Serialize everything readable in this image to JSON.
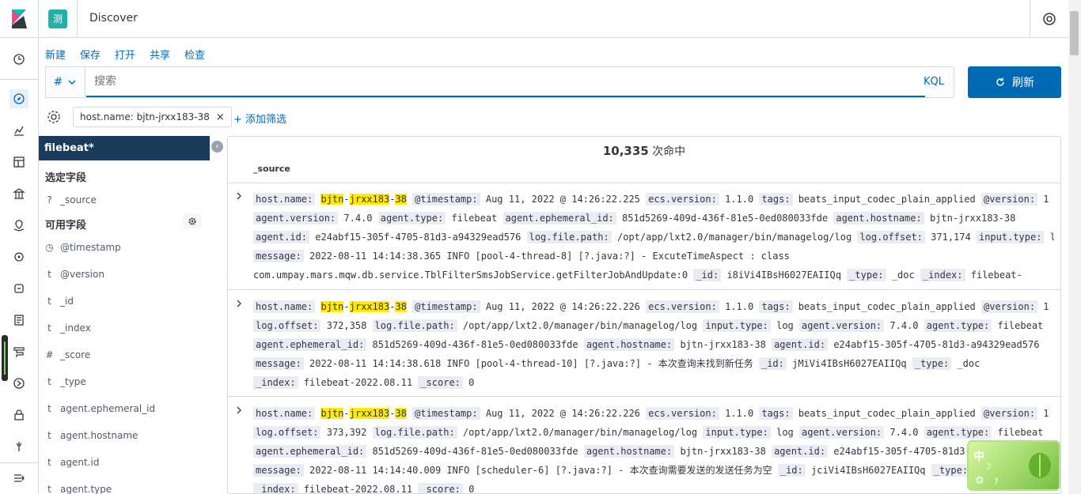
{
  "app": {
    "breadcrumb": "Discover",
    "space_initial": "测"
  },
  "menu": [
    "新建",
    "保存",
    "打开",
    "共享",
    "检查"
  ],
  "query": {
    "lang_symbol": "#",
    "placeholder": "搜索",
    "kql": "KQL",
    "refresh": "刷新"
  },
  "filters": {
    "pill": "host.name: bjtn-jrxx183-38",
    "add": "+ 添加筛选"
  },
  "sidebar": {
    "index": "filebeat*",
    "selected_title": "选定字段",
    "selected": [
      {
        "type": "?",
        "name": "_source"
      }
    ],
    "available_title": "可用字段",
    "available": [
      {
        "type": "◷",
        "name": "@timestamp"
      },
      {
        "type": "t",
        "name": "@version"
      },
      {
        "type": "t",
        "name": "_id"
      },
      {
        "type": "t",
        "name": "_index"
      },
      {
        "type": "#",
        "name": "_score"
      },
      {
        "type": "t",
        "name": "_type"
      },
      {
        "type": "t",
        "name": "agent.ephemeral_id"
      },
      {
        "type": "t",
        "name": "agent.hostname"
      },
      {
        "type": "t",
        "name": "agent.id"
      },
      {
        "type": "t",
        "name": "agent.type"
      }
    ]
  },
  "results": {
    "count": "10,335",
    "count_suffix": "次命中",
    "column": "_source"
  },
  "rows": [
    {
      "lines": [
        [
          [
            "host.name:",
            ""
          ],
          [
            "bjtn",
            "hl"
          ],
          [
            "-",
            ""
          ],
          [
            "jrxx183",
            "hl"
          ],
          [
            "-",
            ""
          ],
          [
            "38",
            "hl"
          ],
          [
            "@timestamp:",
            ""
          ],
          [
            "Aug 11, 2022 @ 14:26:22.225",
            ""
          ],
          [
            "ecs.version:",
            ""
          ],
          [
            "1.1.0",
            ""
          ],
          [
            "tags:",
            ""
          ],
          [
            "beats_input_codec_plain_applied",
            ""
          ],
          [
            "@version:",
            ""
          ],
          [
            "1",
            ""
          ]
        ],
        [
          [
            "agent.version:",
            ""
          ],
          [
            "7.4.0",
            ""
          ],
          [
            "agent.type:",
            ""
          ],
          [
            "filebeat",
            ""
          ],
          [
            "agent.ephemeral_id:",
            ""
          ],
          [
            "851d5269-409d-436f-81e5-0ed080033fde",
            ""
          ],
          [
            "agent.hostname:",
            ""
          ],
          [
            "bjtn-jrxx183-38",
            ""
          ]
        ],
        [
          [
            "agent.id:",
            ""
          ],
          [
            "e24abf15-305f-4705-81d3-a94329ead576",
            ""
          ],
          [
            "log.file.path:",
            ""
          ],
          [
            "/opt/app/lxt2.0/manager/bin/managelog/log",
            ""
          ],
          [
            "log.offset:",
            ""
          ],
          [
            "371,174",
            ""
          ],
          [
            "input.type:",
            ""
          ],
          [
            "log",
            ""
          ]
        ],
        [
          [
            "message:",
            ""
          ],
          [
            "2022-08-11 14:14:38.365 INFO [pool-4-thread-8] [?.java:?] - ExcuteTimeAspect : class",
            ""
          ]
        ],
        [
          [
            "com.umpay.mars.mqw.db.service.TblFilterSmsJobService.getFilterJobAndUpdate:0",
            ""
          ],
          [
            "_id:",
            ""
          ],
          [
            "i8iVi4IBsH6027EAIIQq",
            ""
          ],
          [
            "_type:",
            ""
          ],
          [
            "_doc",
            ""
          ],
          [
            "_index:",
            ""
          ],
          [
            "filebeat-",
            ""
          ]
        ]
      ]
    },
    {
      "lines": [
        [
          [
            "host.name:",
            ""
          ],
          [
            "bjtn",
            "hl"
          ],
          [
            "-",
            ""
          ],
          [
            "jrxx183",
            "hl"
          ],
          [
            "-",
            ""
          ],
          [
            "38",
            "hl"
          ],
          [
            "@timestamp:",
            ""
          ],
          [
            "Aug 11, 2022 @ 14:26:22.226",
            ""
          ],
          [
            "ecs.version:",
            ""
          ],
          [
            "1.1.0",
            ""
          ],
          [
            "tags:",
            ""
          ],
          [
            "beats_input_codec_plain_applied",
            ""
          ],
          [
            "@version:",
            ""
          ],
          [
            "1",
            ""
          ]
        ],
        [
          [
            "log.offset:",
            ""
          ],
          [
            "372,358",
            ""
          ],
          [
            "log.file.path:",
            ""
          ],
          [
            "/opt/app/lxt2.0/manager/bin/managelog/log",
            ""
          ],
          [
            "input.type:",
            ""
          ],
          [
            "log",
            ""
          ],
          [
            "agent.version:",
            ""
          ],
          [
            "7.4.0",
            ""
          ],
          [
            "agent.type:",
            ""
          ],
          [
            "filebeat",
            ""
          ]
        ],
        [
          [
            "agent.ephemeral_id:",
            ""
          ],
          [
            "851d5269-409d-436f-81e5-0ed080033fde",
            ""
          ],
          [
            "agent.hostname:",
            ""
          ],
          [
            "bjtn-jrxx183-38",
            ""
          ],
          [
            "agent.id:",
            ""
          ],
          [
            "e24abf15-305f-4705-81d3-a94329ead576",
            ""
          ]
        ],
        [
          [
            "message:",
            ""
          ],
          [
            "2022-08-11 14:14:38.618 INFO [pool-4-thread-10] [?.java:?] - 本次查询未找到新任务",
            ""
          ],
          [
            "_id:",
            ""
          ],
          [
            "jMiVi4IBsH6027EAIIQq",
            ""
          ],
          [
            "_type:",
            ""
          ],
          [
            "_doc",
            ""
          ]
        ],
        [
          [
            "_index:",
            ""
          ],
          [
            "filebeat-2022.08.11",
            ""
          ],
          [
            "_score:",
            ""
          ],
          [
            "0",
            ""
          ]
        ]
      ]
    },
    {
      "lines": [
        [
          [
            "host.name:",
            ""
          ],
          [
            "bjtn",
            "hl"
          ],
          [
            "-",
            ""
          ],
          [
            "jrxx183",
            "hl"
          ],
          [
            "-",
            ""
          ],
          [
            "38",
            "hl"
          ],
          [
            "@timestamp:",
            ""
          ],
          [
            "Aug 11, 2022 @ 14:26:22.226",
            ""
          ],
          [
            "ecs.version:",
            ""
          ],
          [
            "1.1.0",
            ""
          ],
          [
            "tags:",
            ""
          ],
          [
            "beats_input_codec_plain_applied",
            ""
          ],
          [
            "@version:",
            ""
          ],
          [
            "1",
            ""
          ]
        ],
        [
          [
            "log.offset:",
            ""
          ],
          [
            "373,392",
            ""
          ],
          [
            "log.file.path:",
            ""
          ],
          [
            "/opt/app/lxt2.0/manager/bin/managelog/log",
            ""
          ],
          [
            "input.type:",
            ""
          ],
          [
            "log",
            ""
          ],
          [
            "agent.version:",
            ""
          ],
          [
            "7.4.0",
            ""
          ],
          [
            "agent.type:",
            ""
          ],
          [
            "filebeat",
            ""
          ]
        ],
        [
          [
            "agent.ephemeral_id:",
            ""
          ],
          [
            "851d5269-409d-436f-81e5-0ed080033fde",
            ""
          ],
          [
            "agent.hostname:",
            ""
          ],
          [
            "bjtn-jrxx183-38",
            ""
          ],
          [
            "agent.id:",
            ""
          ],
          [
            "e24abf15-305f-4705-81d3-a9",
            ""
          ]
        ],
        [
          [
            "message:",
            ""
          ],
          [
            "2022-08-11 14:14:40.009 INFO [scheduler-6] [?.java:?] - 本次查询需要发送的发送任务为空",
            ""
          ],
          [
            "_id:",
            ""
          ],
          [
            "jciVi4IBsH6027EAIIQq",
            ""
          ],
          [
            "_type:",
            ""
          ]
        ],
        [
          [
            "_index:",
            ""
          ],
          [
            "filebeat-2022.08.11",
            ""
          ],
          [
            "_score:",
            ""
          ],
          [
            "0",
            ""
          ]
        ]
      ]
    }
  ],
  "ime": {
    "label": "中"
  },
  "colors": {
    "accent": "#006bb4",
    "index_bg": "#1a3b5c",
    "highlight": "#ffea00"
  }
}
